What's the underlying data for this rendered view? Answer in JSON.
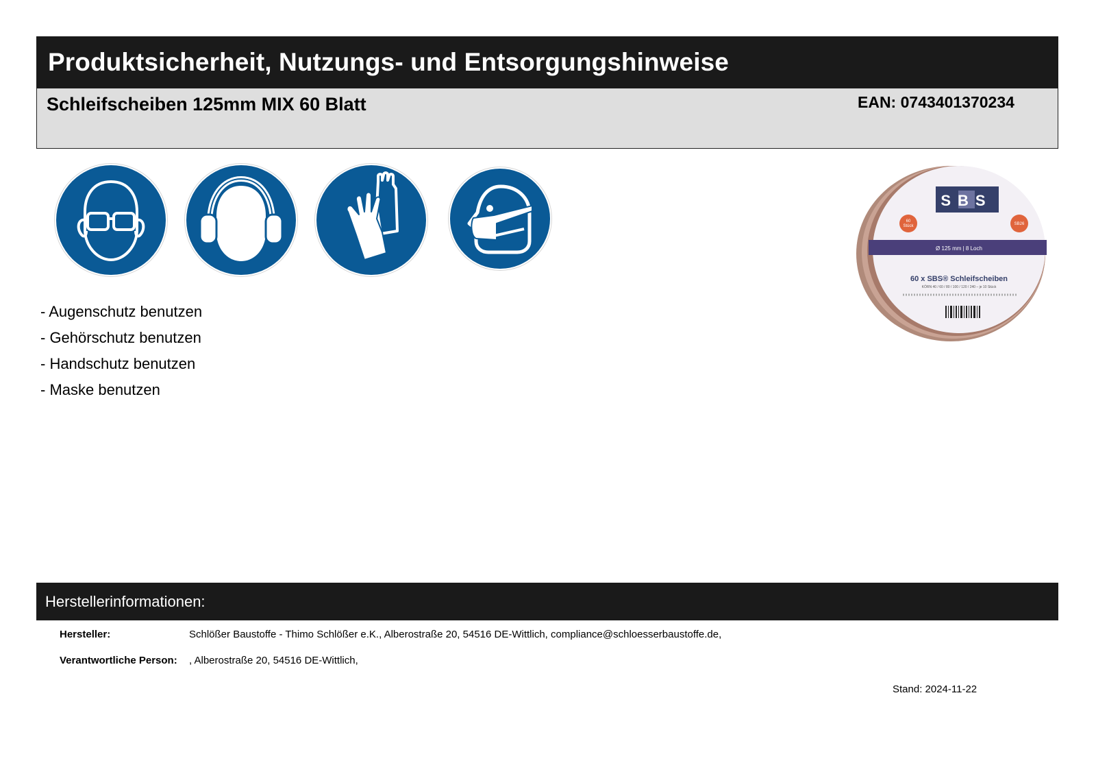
{
  "document": {
    "title": "Produktsicherheit, Nutzungs- und Entsorgungshinweise",
    "product_name": "Schleifscheiben 125mm MIX 60 Blatt",
    "ean": "EAN: 0743401370234"
  },
  "safety_icons": [
    {
      "name": "eye-protection-icon"
    },
    {
      "name": "ear-protection-icon"
    },
    {
      "name": "hand-protection-icon"
    },
    {
      "name": "mask-icon"
    }
  ],
  "instructions": [
    "- Augenschutz benutzen",
    "- Gehörschutz benutzen",
    "- Handschutz benutzen",
    "- Maske benutzen"
  ],
  "product_image": {
    "brand": "SBS",
    "badge_left_1": "60",
    "badge_left_2": "Stück",
    "badge_right": "SB26",
    "band_text": "Ø 125 mm  |  8 Loch",
    "caption": "60 x SBS® Schleifscheiben",
    "caption_sub": "KÖRN 40 / 60 / 80 / 100 / 120 / 240 – je 10 Stück"
  },
  "manufacturer": {
    "heading": "Herstellerinformationen:",
    "rows": [
      {
        "label": "Hersteller:",
        "value": "Schlößer Baustoffe - Thimo Schlößer e.K., Alberostraße 20, 54516 DE-Wittlich, compliance@schloesserbaustoffe.de,"
      },
      {
        "label": "Verantwortliche Person:",
        "value": ", Alberostraße 20, 54516 DE-Wittlich,"
      }
    ],
    "stand": "Stand: 2024-11-22"
  },
  "colors": {
    "header_bg": "#1a1a1a",
    "product_bar_bg": "#dedede",
    "safety_blue": "#0a5a96",
    "brand_navy": "#35406a",
    "badge_orange": "#e0643c"
  }
}
